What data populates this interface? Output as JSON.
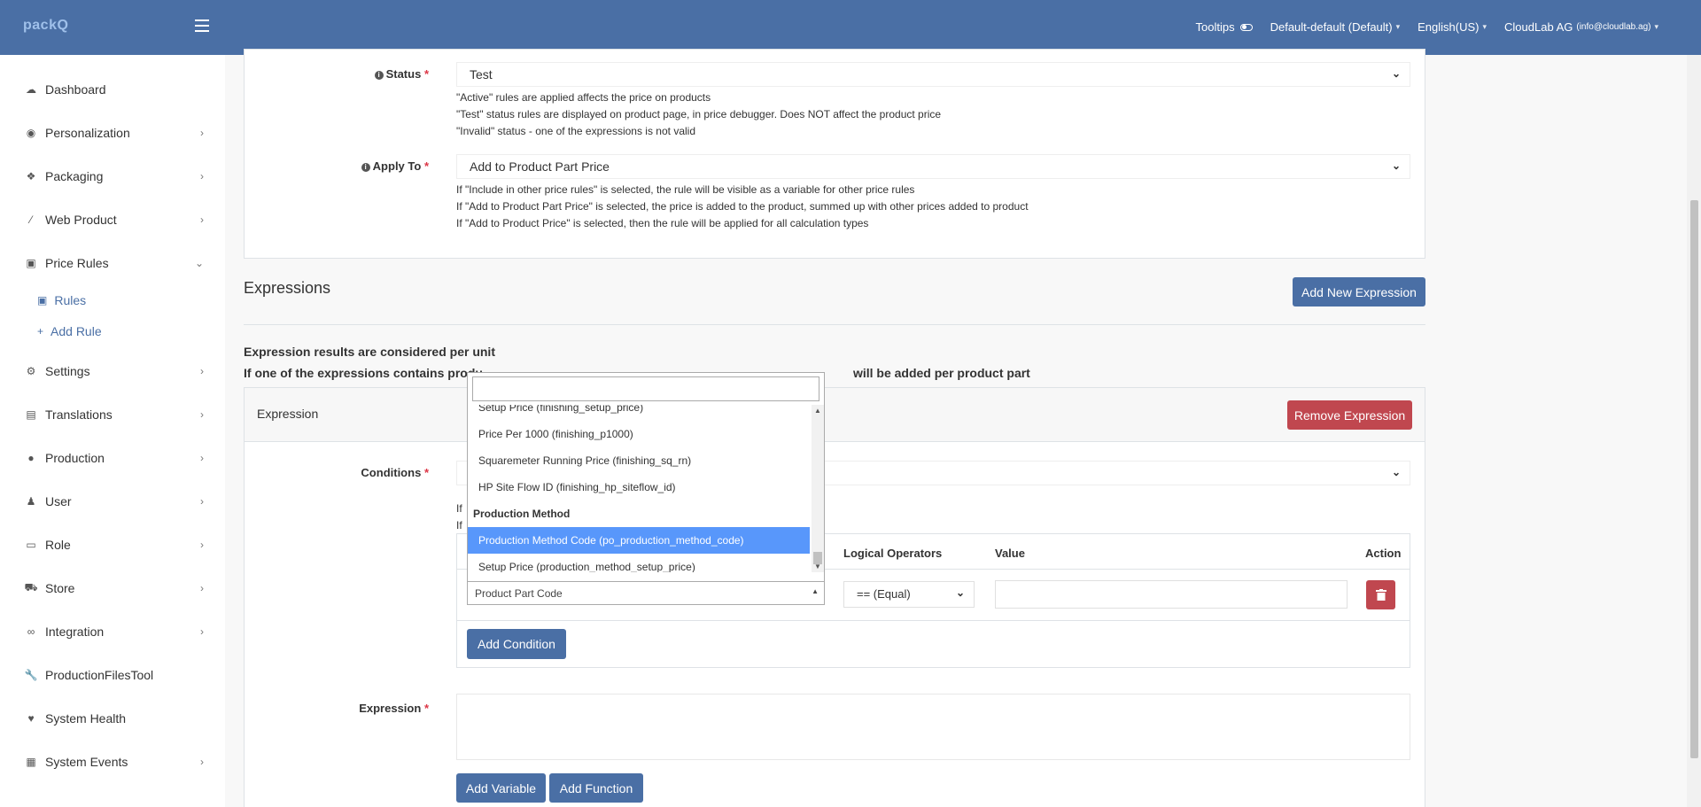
{
  "app": {
    "logo": "packQ"
  },
  "topbar": {
    "tooltips_label": "Tooltips",
    "store_selector": "Default-default (Default)",
    "language": "English(US)",
    "account_name": "CloudLab AG",
    "account_email": "(info@cloudlab.ag)"
  },
  "sidebar": {
    "items": [
      {
        "label": "Dashboard",
        "icon": "cloud-icon"
      },
      {
        "label": "Personalization",
        "icon": "eye-icon"
      },
      {
        "label": "Packaging",
        "icon": "dropbox-icon"
      },
      {
        "label": "Web Product",
        "icon": "magic-wand-icon"
      },
      {
        "label": "Price Rules",
        "icon": "money-icon"
      },
      {
        "label": "Settings",
        "icon": "gears-icon"
      },
      {
        "label": "Translations",
        "icon": "language-icon"
      },
      {
        "label": "Production",
        "icon": "product-hunt-icon"
      },
      {
        "label": "User",
        "icon": "user-icon"
      },
      {
        "label": "Role",
        "icon": "id-card-icon"
      },
      {
        "label": "Store",
        "icon": "cart-icon"
      },
      {
        "label": "Integration",
        "icon": "link-icon"
      },
      {
        "label": "ProductionFilesTool",
        "icon": "wrench-icon"
      },
      {
        "label": "System Health",
        "icon": "heartbeat-icon"
      },
      {
        "label": "System Events",
        "icon": "calendar-icon"
      }
    ],
    "subitems": [
      {
        "label": "Rules",
        "icon": "money-icon"
      },
      {
        "label": "Add Rule",
        "icon": "plus-icon"
      }
    ]
  },
  "form": {
    "status": {
      "label": "Status",
      "value": "Test",
      "help": [
        "\"Active\" rules are applied affects the price on products",
        "\"Test\" status rules are displayed on product page, in price debugger. Does NOT affect the product price",
        "\"Invalid\" status - one of the expressions is not valid"
      ]
    },
    "apply_to": {
      "label": "Apply To",
      "value": "Add to Product Part Price",
      "help": [
        "If \"Include in other price rules\" is selected, the rule will be visible as a variable for other price rules",
        "If \"Add to Product Part Price\" is selected, the price is added to the product, summed up with other prices added to product",
        "If \"Add to Product Price\" is selected, then the rule will be applied for all calculation types"
      ]
    }
  },
  "expressions": {
    "title": "Expressions",
    "add_button": "Add New Expression",
    "note1": "Expression results are considered per unit",
    "note2_start": "If one of the expressions contains produ",
    "note2_end": "will be added per product part",
    "expression_header": "Expression",
    "remove_button": "Remove Expression",
    "conditions_label": "Conditions",
    "help_partial": [
      "If",
      "If"
    ],
    "columns": {
      "logical": "Logical Operators",
      "value": "Value",
      "action": "Action"
    },
    "operator_value": "== (Equal)",
    "add_condition": "Add Condition",
    "expression_label": "Expression",
    "add_variable": "Add Variable",
    "add_function": "Add Function"
  },
  "dropdown": {
    "search_value": "",
    "options": [
      {
        "type": "option",
        "label": "Setup Price (finishing_setup_price)"
      },
      {
        "type": "option",
        "label": "Price Per 1000 (finishing_p1000)"
      },
      {
        "type": "option",
        "label": "Squaremeter Running Price (finishing_sq_rn)"
      },
      {
        "type": "option",
        "label": "HP Site Flow ID (finishing_hp_siteflow_id)"
      },
      {
        "type": "group",
        "label": "Production Method"
      },
      {
        "type": "option",
        "label": "Production Method Code (po_production_method_code)",
        "selected": true
      },
      {
        "type": "option",
        "label": "Setup Price (production_method_setup_price)"
      }
    ],
    "current_value": "Product Part Code"
  },
  "colors": {
    "primary": "#4a6fa5",
    "danger": "#c0474f",
    "highlight": "#5897fb"
  }
}
